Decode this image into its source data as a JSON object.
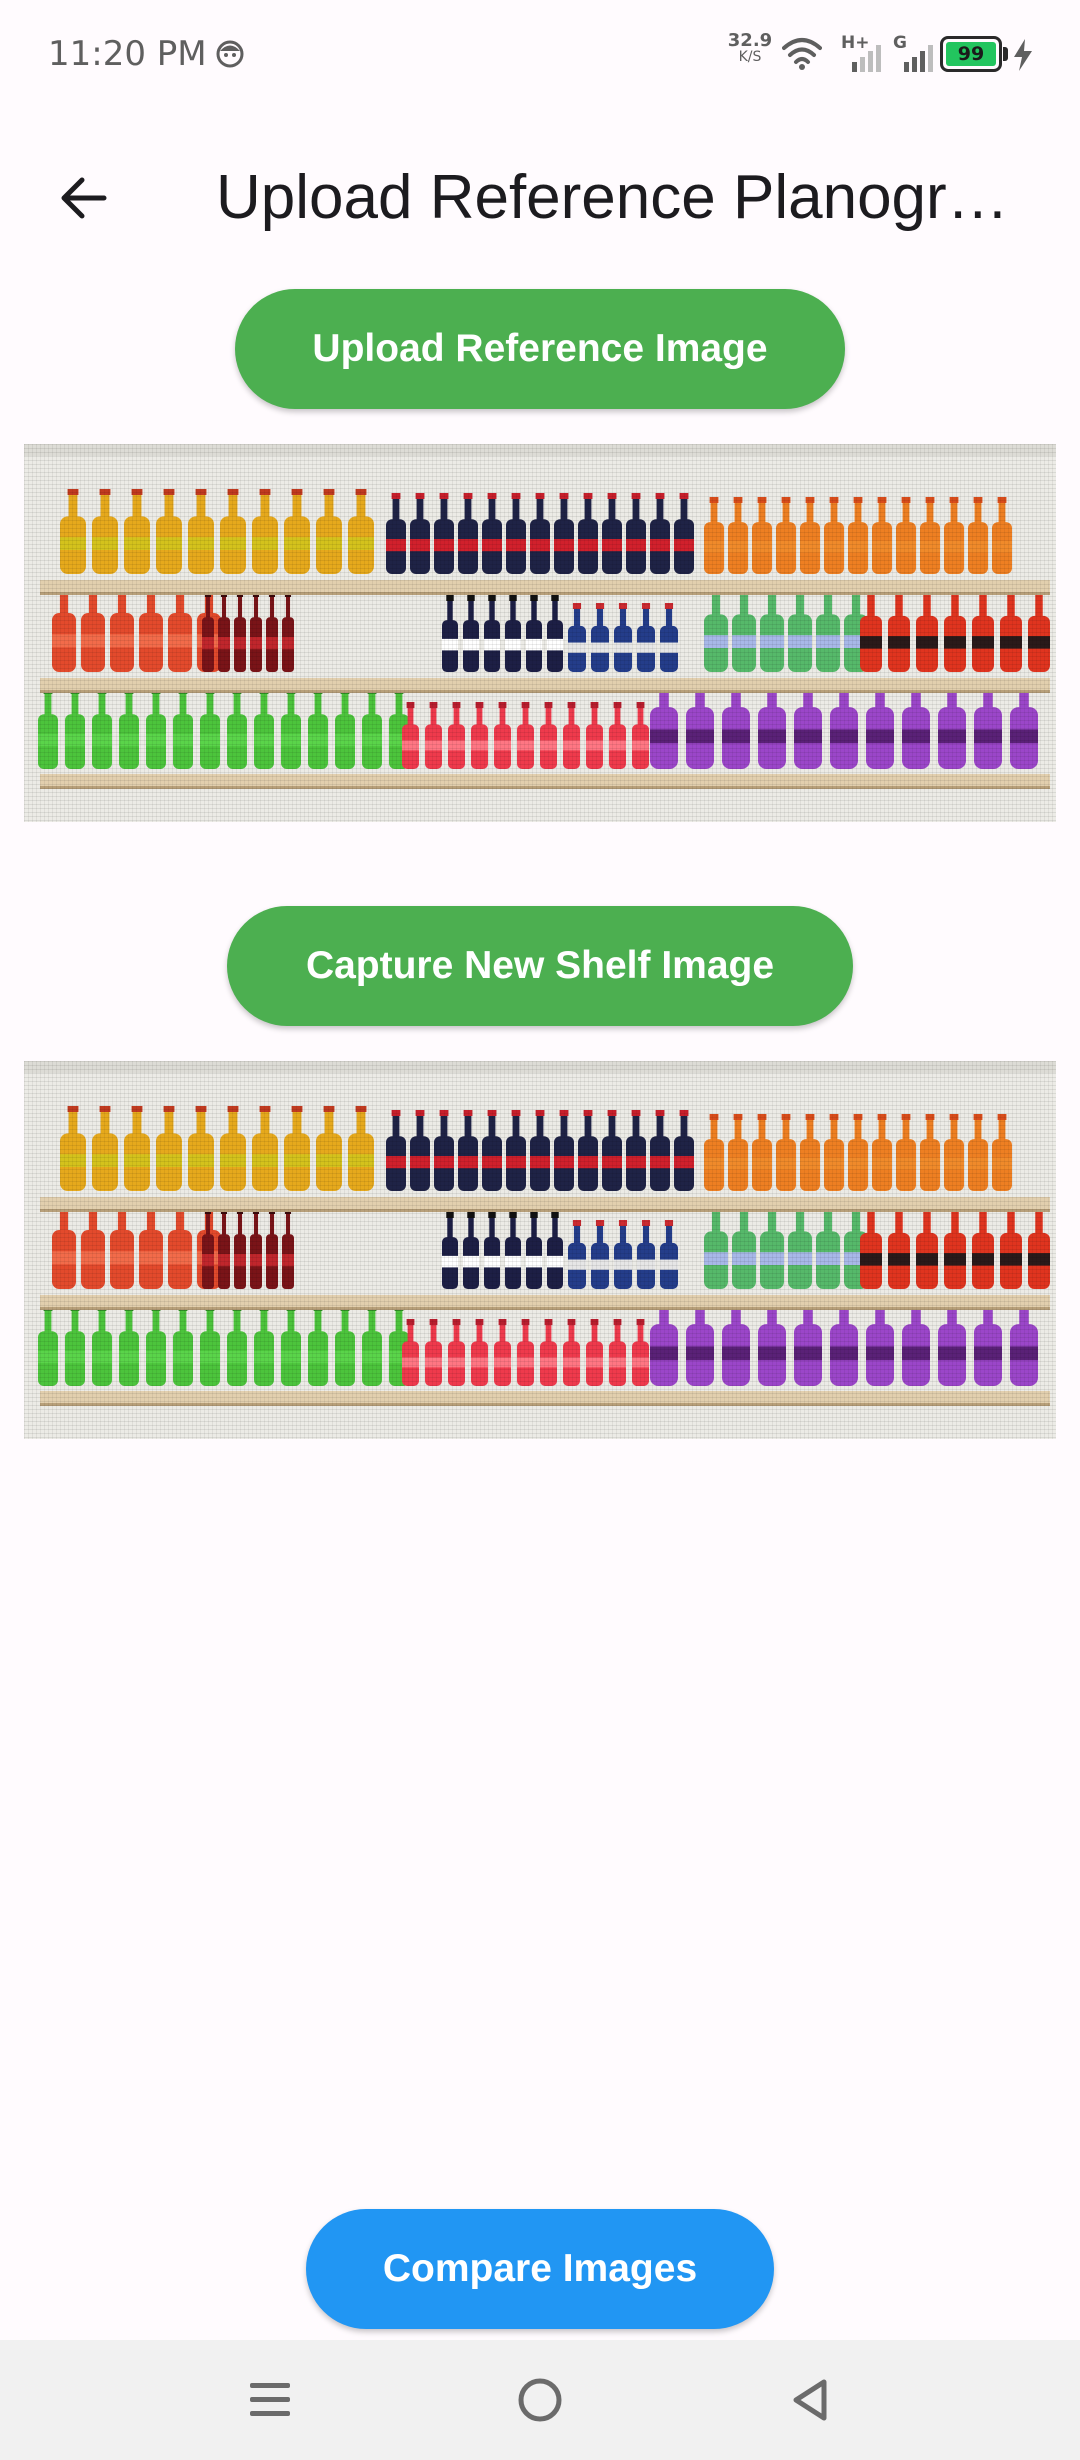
{
  "status_bar": {
    "time": "11:20 PM",
    "net_speed_value": "32.9",
    "net_speed_unit": "K/S",
    "battery_level": "99",
    "icons": [
      "face-icon",
      "wifi-icon",
      "signal-hplus-icon",
      "signal-g-icon",
      "battery-icon",
      "charging-icon"
    ]
  },
  "app_bar": {
    "back_icon": "arrow-back-icon",
    "title": "Upload Reference Planogram"
  },
  "actions": {
    "upload_reference_label": "Upload Reference Image",
    "capture_shelf_label": "Capture New Shelf Image",
    "compare_label": "Compare Images"
  },
  "images": {
    "reference_image": "planogram-shelf-photo",
    "captured_image": "planogram-shelf-photo"
  },
  "nav_bar": {
    "icons": [
      "menu-icon",
      "home-icon",
      "back-triangle-icon"
    ]
  },
  "colors": {
    "primary_green": "#4caf50",
    "primary_blue": "#2196f3",
    "background": "#fffbfe"
  }
}
